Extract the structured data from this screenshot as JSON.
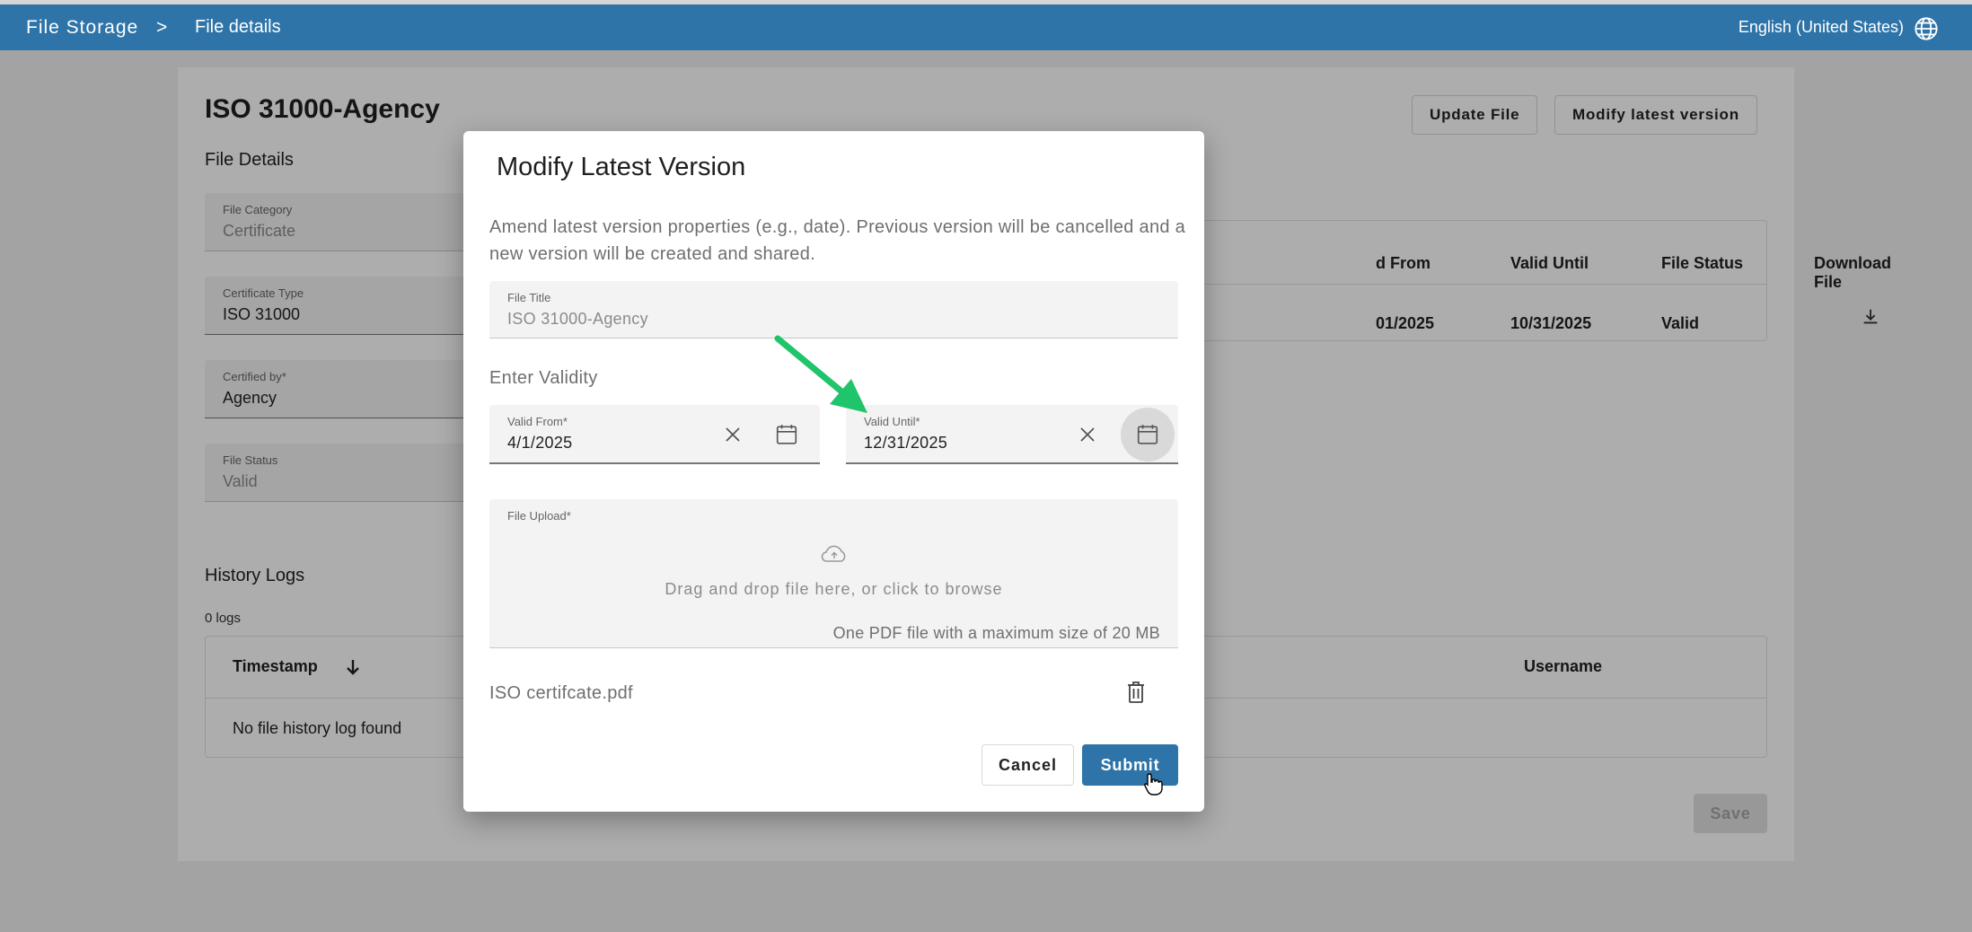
{
  "header": {
    "breadcrumb_root": "File Storage",
    "breadcrumb_separator": ">",
    "breadcrumb_current": "File details",
    "language": "English (United States)",
    "language_icon": "globe-icon"
  },
  "page": {
    "title": "ISO 31000-Agency",
    "update_file_label": "Update File",
    "modify_latest_label": "Modify latest version",
    "file_details_heading": "File Details",
    "fields": [
      {
        "label": "File Category",
        "value": "Certificate"
      },
      {
        "label": "Certificate Type",
        "value": "ISO 31000"
      },
      {
        "label": "Certified by*",
        "value": "Agency"
      },
      {
        "label": "File Status",
        "value": "Valid"
      }
    ],
    "files_table": {
      "headers": [
        "d From",
        "Valid Until",
        "File Status",
        "Download File"
      ],
      "row": [
        "01/2025",
        "10/31/2025",
        "Valid"
      ],
      "download_icon": "download-icon"
    },
    "history_heading": "History Logs",
    "logs_count": "0 logs",
    "logs_table": {
      "headers": [
        "Timestamp",
        "Username"
      ],
      "empty_text": "No file history log found",
      "sort_icon": "arrow-down-icon"
    },
    "save_label": "Save"
  },
  "dialog": {
    "title": "Modify Latest Version",
    "description": "Amend latest version properties (e.g., date). Previous version will be cancelled and a new version will be created and shared.",
    "file_title_label": "File Title",
    "file_title_value": "ISO 31000-Agency",
    "validity_label": "Enter Validity",
    "valid_from_label": "Valid From*",
    "valid_from_value": "4/1/2025",
    "valid_until_label": "Valid Until*",
    "valid_until_value": "12/31/2025",
    "upload_label": "File Upload*",
    "upload_hint": "Drag and drop file here, or click to browse",
    "upload_limit": "One PDF file with a maximum size of 20 MB",
    "file_name": "ISO certifcate.pdf",
    "cancel_label": "Cancel",
    "submit_label": "Submit"
  },
  "colors": {
    "primary": "#2e74a8",
    "annotation_arrow": "#1fc46b"
  }
}
